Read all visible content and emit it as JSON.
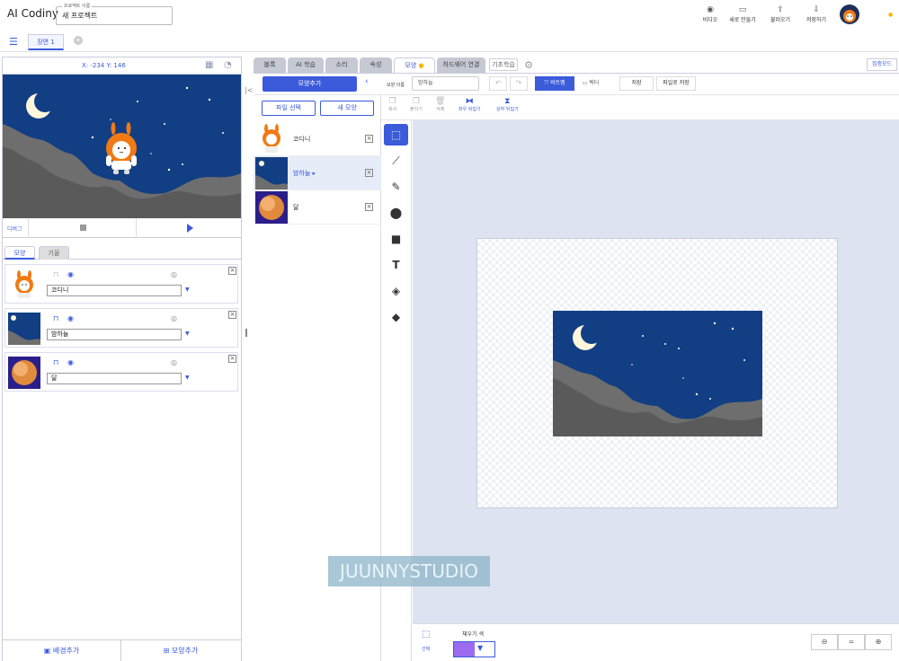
{
  "header": {
    "logo": "AI Codiny",
    "project_label": "프로젝트 이름",
    "project_name": "새 프로젝트",
    "buttons": [
      {
        "label": "비디오",
        "icon": "video-icon"
      },
      {
        "label": "새로 만들기",
        "icon": "new-file-icon"
      },
      {
        "label": "불러오기",
        "icon": "upload-icon"
      },
      {
        "label": "저장하기",
        "icon": "download-icon"
      }
    ]
  },
  "scenes": {
    "tab": "장면 1"
  },
  "stage": {
    "coords": "X: -234 Y: 146",
    "debug": "디버그"
  },
  "left_tabs": {
    "shape": "모양",
    "tilt": "기울"
  },
  "objects": [
    {
      "name": "코디니"
    },
    {
      "name": "밤하늘"
    },
    {
      "name": "달"
    }
  ],
  "left_bottom": {
    "add_bg": "배경추가",
    "add_shape": "모양추가"
  },
  "right_tabs": [
    "블록",
    "AI 학습",
    "소리",
    "속성",
    "모양",
    "하드웨어 연결",
    "기초학습"
  ],
  "focus_mode": "집중모드",
  "costume_toolbar": {
    "add_costume": "모양추가",
    "name_label": "모양 이름",
    "name_value": "밤하늘",
    "bitmap": "비트맵",
    "vector": "벡터",
    "save": "저장",
    "save_file": "파일로 저장"
  },
  "costume_list": {
    "file_select": "파일 선택",
    "new_shape": "새 모양",
    "items": [
      "코디니",
      "밤하늘",
      "달"
    ]
  },
  "edit_bar": [
    "복사",
    "붙이기",
    "삭제",
    "좌우 뒤집기",
    "상하 뒤집기"
  ],
  "watermark": "JUUNNYSTUDIO",
  "bottom": {
    "select_label": "선택",
    "fill_label": "채우기 색",
    "fill_color": "#9b6bf0",
    "zoom": [
      "−",
      "=",
      "+"
    ]
  },
  "colors": {
    "accent": "#3b5bdb",
    "sky": "#123e84"
  }
}
